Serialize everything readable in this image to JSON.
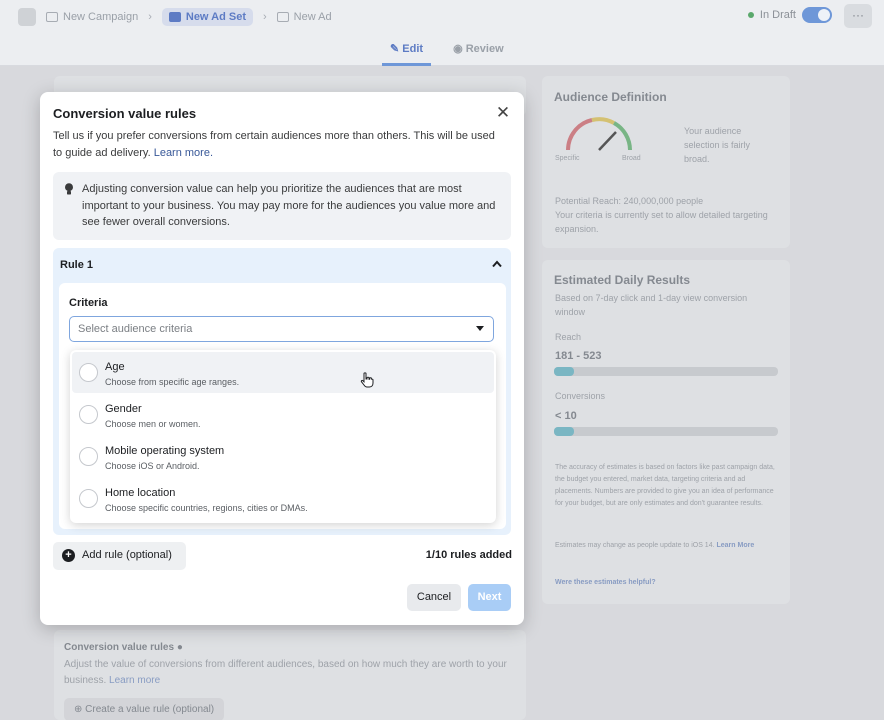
{
  "topbar": {
    "breadcrumbs": [
      "New Campaign",
      "New Ad Set",
      "New Ad"
    ],
    "draft_status": "In Draft",
    "more_label": "···"
  },
  "edit_tabs": [
    "Edit",
    "Review"
  ],
  "background": {
    "audience_title": "Audience Definition",
    "gauge_left": "Specific",
    "gauge_right": "Broad",
    "audience_summary": "Your audience selection is fairly broad.",
    "potential_reach": "Potential Reach: 240,000,000 people",
    "criteria_note": "Your criteria is currently set to allow detailed targeting expansion.",
    "results_title": "Estimated Daily Results",
    "results_sub": "Based on 7-day click and 1-day view conversion window",
    "reach_label": "Reach",
    "reach_value": "181 - 523",
    "reach_fill": 0.09,
    "conversions_label": "Conversions",
    "conversions_value": "< 10",
    "conversions_fill": 0.09,
    "accuracy_note": "The accuracy of estimates is based on factors like past campaign data, the budget you entered, market data, targeting criteria and ad placements. Numbers are provided to give you an idea of performance for your budget, but are only estimates and don't guarantee results.",
    "currency_note": "Estimates may change as people update to iOS 14.",
    "currency_link": "Learn More",
    "helpful_link": "Were these estimates helpful?",
    "cv_title": "Conversion value rules",
    "cv_desc": "Adjust the value of conversions from different audiences, based on how much they are worth to your business.",
    "cv_link": "Learn more",
    "cv_button": "Create a value rule (optional)"
  },
  "modal": {
    "title": "Conversion value rules",
    "intro": "Tell us if you prefer conversions from certain audiences more than others. This will be used to guide ad delivery.",
    "intro_link": "Learn more.",
    "tip": "Adjusting conversion value can help you prioritize the audiences that are most important to your business. You may pay more for the audiences you value more and see fewer overall conversions.",
    "rule_label": "Rule 1",
    "criteria_label": "Criteria",
    "select_placeholder": "Select audience criteria",
    "options": [
      {
        "title": "Age",
        "desc": "Choose from specific age ranges."
      },
      {
        "title": "Gender",
        "desc": "Choose men or women."
      },
      {
        "title": "Mobile operating system",
        "desc": "Choose iOS or Android."
      },
      {
        "title": "Home location",
        "desc": "Choose specific countries, regions, cities or DMAs."
      }
    ],
    "add_rule": "Add rule (optional)",
    "rules_count": "1/10 rules added",
    "cancel": "Cancel",
    "next": "Next"
  },
  "colors": {
    "accent": "#1877f2",
    "next_disabled": "#a9cdf6",
    "rule_bg": "#e7f1fc"
  }
}
